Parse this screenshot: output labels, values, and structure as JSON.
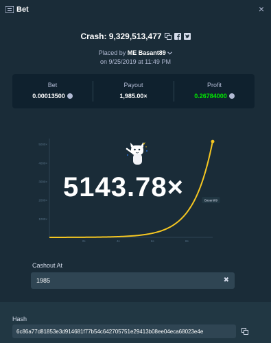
{
  "window": {
    "title": "Bet",
    "icons": {
      "bet": "bet-list-icon",
      "close": "close-icon"
    },
    "close_glyph": "×"
  },
  "crash": {
    "label": "Crash: 9,329,513,477",
    "icons": [
      "copy-icon",
      "facebook-icon",
      "twitter-icon"
    ]
  },
  "placed": {
    "prefix": "Placed by",
    "user": "ME Basant89",
    "dropdown_icon": "chevron-down-icon",
    "date": "on 9/25/2019 at 11:49 PM"
  },
  "stats": {
    "bet": {
      "label": "Bet",
      "value": "0.00013500"
    },
    "payout": {
      "label": "Payout",
      "value": "1,985.00×"
    },
    "profit": {
      "label": "Profit",
      "value": "0.26784000"
    },
    "currency_icon": "coin-icon"
  },
  "chart_data": {
    "type": "line",
    "title": "",
    "xlabel": "",
    "ylabel": "",
    "x_ticks": [
      "2s",
      "4s",
      "6s",
      "8s"
    ],
    "y_ticks": [
      "1000×",
      "2000×",
      "3000×",
      "4000×",
      "5000×"
    ],
    "xlim": [
      0,
      9.5
    ],
    "ylim": [
      0,
      5300
    ],
    "growth_rate": 0.9,
    "end_x": 9.5,
    "end_y": 5143.78,
    "cashout_marker": {
      "label": "Basant89",
      "x": 9.12,
      "y": 1985
    },
    "multiplier_label": "5143.78×",
    "mascot_icon": "cat-mascot-icon",
    "line_color": "#f6c721",
    "grid": false,
    "legend": "none"
  },
  "cashout": {
    "label": "Cashout At",
    "value": "1985",
    "clear_icon": "clear-icon",
    "clear_glyph": "✖"
  },
  "hash": {
    "label": "Hash",
    "value": "6c86a77d81853e3d914681f77b54c642705751e29413b08ee04eca68023e4e",
    "copy_icon": "copy-icon"
  },
  "colors": {
    "background": "#1a2c38",
    "panel": "#0f212e",
    "input": "#2f4553",
    "profit": "#00e701",
    "curve": "#f6c721"
  }
}
